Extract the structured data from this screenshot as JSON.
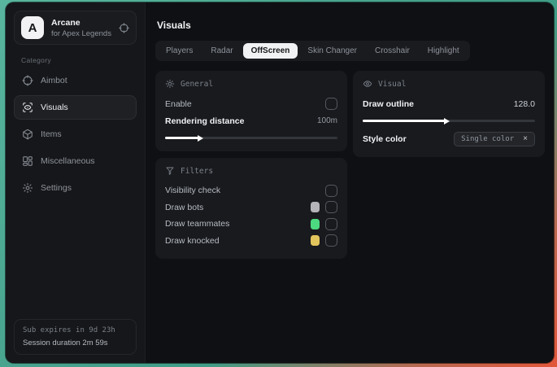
{
  "app": {
    "name": "Arcane",
    "subtitle": "for Apex Legends",
    "logo_letter": "A"
  },
  "sidebar": {
    "category_label": "Category",
    "items": [
      {
        "label": "Aimbot",
        "icon": "crosshair-icon",
        "selected": false
      },
      {
        "label": "Visuals",
        "icon": "scan-eye-icon",
        "selected": true
      },
      {
        "label": "Items",
        "icon": "package-icon",
        "selected": false
      },
      {
        "label": "Miscellaneous",
        "icon": "layout-dashboard-icon",
        "selected": false
      },
      {
        "label": "Settings",
        "icon": "gear-icon",
        "selected": false
      }
    ],
    "footer": {
      "line1": "Sub expires in 9d 23h",
      "line2": "Session duration 2m 59s"
    }
  },
  "main": {
    "title": "Visuals",
    "tabs": [
      {
        "label": "Players",
        "active": false
      },
      {
        "label": "Radar",
        "active": false
      },
      {
        "label": "OffScreen",
        "active": true
      },
      {
        "label": "Skin Changer",
        "active": false
      },
      {
        "label": "Crosshair",
        "active": false
      },
      {
        "label": "Highlight",
        "active": false
      }
    ],
    "panels": {
      "general": {
        "title": "General",
        "icon": "sun-gear-icon",
        "enable_label": "Enable",
        "enable_checked": false,
        "distance_label": "Rendering distance",
        "distance_value": "100m",
        "distance_percent": 20
      },
      "visual": {
        "title": "Visual",
        "icon": "eye-icon",
        "outline_label": "Draw outline",
        "outline_value": "128.0",
        "outline_percent": 48,
        "style_label": "Style color",
        "style_value": "Single color",
        "style_clear": "×"
      },
      "filters": {
        "title": "Filters",
        "icon": "funnel-icon",
        "rows": [
          {
            "label": "Visibility check",
            "checked": false
          },
          {
            "label": "Draw bots",
            "checked": false,
            "swatch": "#b4b4b9"
          },
          {
            "label": "Draw teammates",
            "checked": false,
            "swatch": "#4cd97f"
          },
          {
            "label": "Draw knocked",
            "checked": false,
            "swatch": "#e2c45c"
          }
        ]
      }
    }
  },
  "colors": {
    "window_bg": "#0f1013",
    "sidebar_bg": "#16171a",
    "panel_bg": "#191a1e",
    "active_tab_bg": "#f1f2f4",
    "slider_fill": "#ffffff",
    "desktop_teal": "#46a28c",
    "desktop_orange": "#e2573a"
  }
}
